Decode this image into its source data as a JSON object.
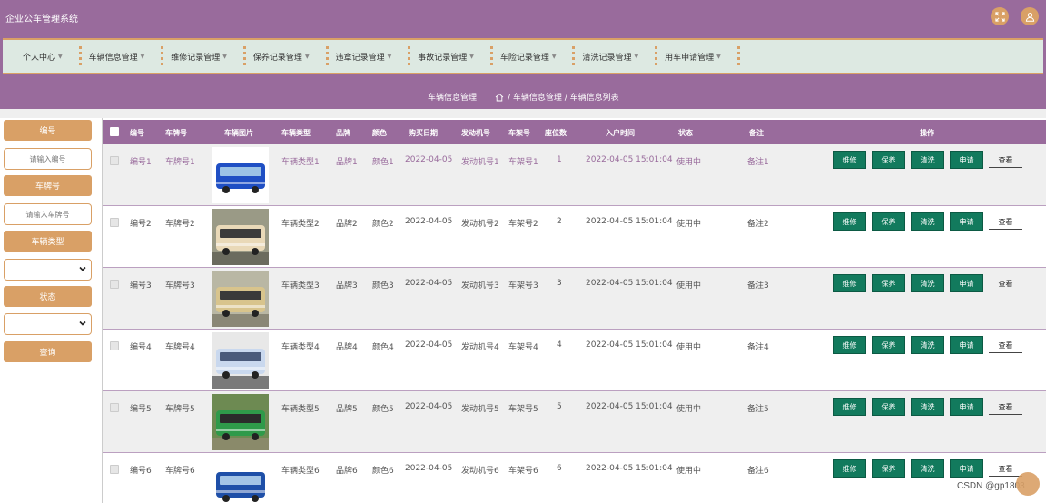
{
  "app": {
    "title": "企业公车管理系统"
  },
  "colors": {
    "primary": "#996b9c",
    "accent": "#d9a066",
    "op_button": "#127a5d",
    "nav_bg": "#dde9e2"
  },
  "header": {
    "icons": [
      "fullscreen-icon",
      "user-icon"
    ]
  },
  "nav": {
    "items": [
      {
        "label": "个人中心"
      },
      {
        "label": "车辆信息管理"
      },
      {
        "label": "维修记录管理"
      },
      {
        "label": "保养记录管理"
      },
      {
        "label": "违章记录管理"
      },
      {
        "label": "事故记录管理"
      },
      {
        "label": "车险记录管理"
      },
      {
        "label": "清洗记录管理"
      },
      {
        "label": "用车申请管理"
      }
    ]
  },
  "breadcrumb": {
    "page": "车辆信息管理",
    "path": "/ 车辆信息管理 / 车辆信息列表"
  },
  "search": {
    "id_label": "编号",
    "id_placeholder": "请输入编号",
    "plate_label": "车牌号",
    "plate_placeholder": "请输入车牌号",
    "type_label": "车辆类型",
    "status_label": "状态",
    "query_button": "查询"
  },
  "table": {
    "headers": {
      "id": "编号",
      "plate": "车牌号",
      "image": "车辆图片",
      "type": "车辆类型",
      "brand": "品牌",
      "color": "颜色",
      "date": "购买日期",
      "engine": "发动机号",
      "frame": "车架号",
      "seats": "座位数",
      "time": "入户时间",
      "status": "状态",
      "note": "备注",
      "ops": "操作"
    },
    "op_buttons": {
      "repair": "维修",
      "maint": "保养",
      "wash": "清洗",
      "apply": "申请",
      "view": "查看"
    },
    "rows": [
      {
        "id": "编号1",
        "plate": "车牌号1",
        "type": "车辆类型1",
        "brand": "品牌1",
        "color": "颜色1",
        "date": "2022-04-05",
        "engine": "发动机号1",
        "frame": "车架号1",
        "seats": "1",
        "time": "2022-04-05 15:01:04",
        "status": "使用中",
        "note": "备注1"
      },
      {
        "id": "编号2",
        "plate": "车牌号2",
        "type": "车辆类型2",
        "brand": "品牌2",
        "color": "颜色2",
        "date": "2022-04-05",
        "engine": "发动机号2",
        "frame": "车架号2",
        "seats": "2",
        "time": "2022-04-05 15:01:04",
        "status": "使用中",
        "note": "备注2"
      },
      {
        "id": "编号3",
        "plate": "车牌号3",
        "type": "车辆类型3",
        "brand": "品牌3",
        "color": "颜色3",
        "date": "2022-04-05",
        "engine": "发动机号3",
        "frame": "车架号3",
        "seats": "3",
        "time": "2022-04-05 15:01:04",
        "status": "使用中",
        "note": "备注3"
      },
      {
        "id": "编号4",
        "plate": "车牌号4",
        "type": "车辆类型4",
        "brand": "品牌4",
        "color": "颜色4",
        "date": "2022-04-05",
        "engine": "发动机号4",
        "frame": "车架号4",
        "seats": "4",
        "time": "2022-04-05 15:01:04",
        "status": "使用中",
        "note": "备注4"
      },
      {
        "id": "编号5",
        "plate": "车牌号5",
        "type": "车辆类型5",
        "brand": "品牌5",
        "color": "颜色5",
        "date": "2022-04-05",
        "engine": "发动机号5",
        "frame": "车架号5",
        "seats": "5",
        "time": "2022-04-05 15:01:04",
        "status": "使用中",
        "note": "备注5"
      },
      {
        "id": "编号6",
        "plate": "车牌号6",
        "type": "车辆类型6",
        "brand": "品牌6",
        "color": "颜色6",
        "date": "2022-04-05",
        "engine": "发动机号6",
        "frame": "车架号6",
        "seats": "6",
        "time": "2022-04-05 15:01:04",
        "status": "使用中",
        "note": "备注6"
      }
    ]
  },
  "watermark": "CSDN @gp1803"
}
